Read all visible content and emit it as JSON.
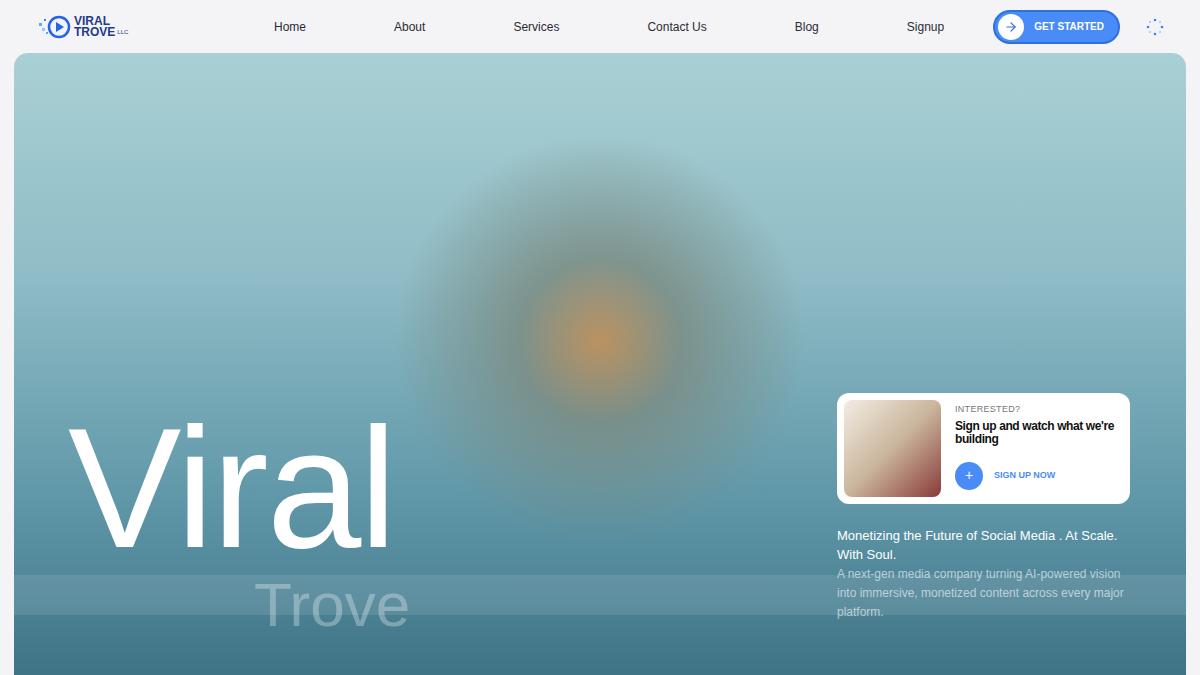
{
  "logo": {
    "name": "VIRAL",
    "sub": "TROVE",
    "suffix": "LLC"
  },
  "nav": {
    "links": [
      {
        "label": "Home"
      },
      {
        "label": "About"
      },
      {
        "label": "Services"
      },
      {
        "label": "Contact Us"
      },
      {
        "label": "Blog"
      },
      {
        "label": "Signup"
      }
    ]
  },
  "cta": {
    "label": "GET STARTED"
  },
  "hero": {
    "title": "Viral",
    "subtitle": "Trove",
    "tagline": "Monetizing the Future of Social Media . At Scale. With Soul.",
    "description": "A next-gen media company turning AI-powered vision into immersive, monetized content across every major platform."
  },
  "card": {
    "eyebrow": "INTERESTED?",
    "title": "Sign up and watch what we're building",
    "button": "SIGN UP NOW",
    "button_icon": "+"
  }
}
